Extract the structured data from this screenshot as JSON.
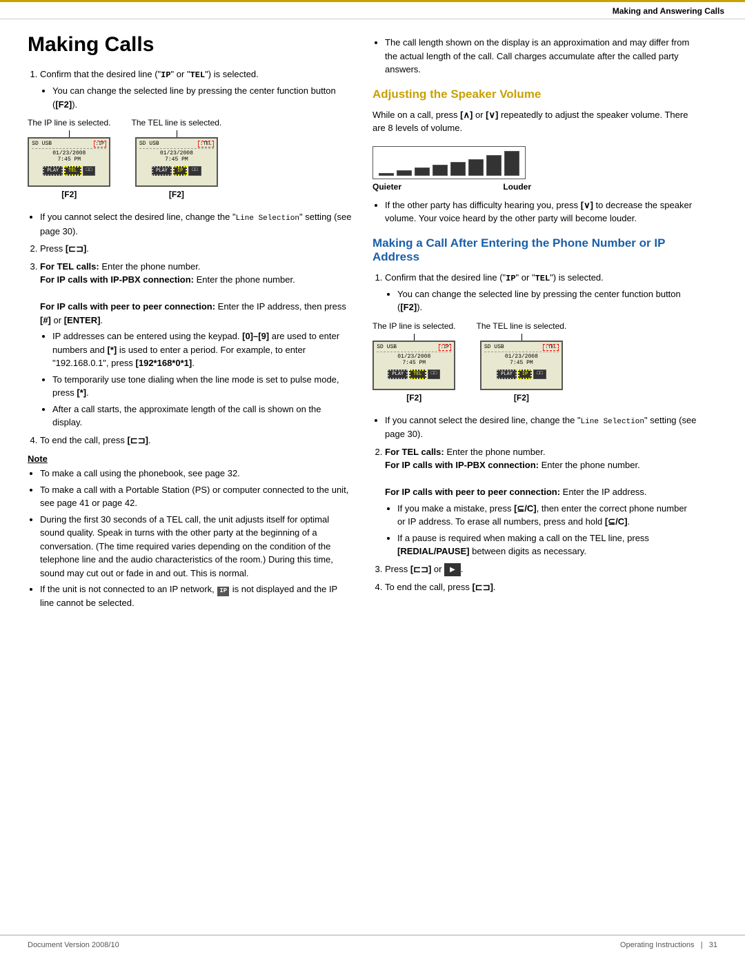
{
  "header": {
    "section_title": "Making and Answering Calls",
    "top_bar_color": "#c8a000"
  },
  "left_column": {
    "main_title": "Making Calls",
    "steps": [
      {
        "num": "1.",
        "text": "Confirm that the desired line (\"IP\" or \"TEL\") is selected.",
        "sub_bullets": [
          "You can change the selected line by pressing the center function button ([F2])."
        ]
      }
    ],
    "display_section": {
      "ip_label": "The IP line is selected.",
      "tel_label": "The TEL line is selected.",
      "f2_label": "[F2]",
      "f2_label2": "[F2]"
    },
    "after_display_bullets": [
      "If you cannot select the desired line, change the \"Line Selection\" setting (see page 30)."
    ],
    "step2": {
      "num": "2.",
      "text": "Press [⊏⊐]."
    },
    "step3": {
      "num": "3.",
      "text_parts": [
        {
          "bold": true,
          "text": "For TEL calls:"
        },
        {
          "bold": false,
          "text": " Enter the phone number."
        },
        {
          "bold": true,
          "text": "\nFor IP calls with IP-PBX connection:"
        },
        {
          "bold": false,
          "text": " Enter the phone number."
        },
        {
          "bold": true,
          "text": "\nFor IP calls with peer to peer connection:"
        },
        {
          "bold": false,
          "text": " Enter the IP address, then press [#] or [ENTER]."
        }
      ],
      "sub_bullets": [
        "IP addresses can be entered using the keypad. [0]–[9] are used to enter numbers and [*] is used to enter a period. For example, to enter \"192.168.0.1\", press [192*168*0*1].",
        "To temporarily use tone dialing when the line mode is set to pulse mode, press [*].",
        "After a call starts, the approximate length of the call is shown on the display."
      ]
    },
    "step4": {
      "num": "4.",
      "text": "To end the call, press [⊏⊐]."
    },
    "note_section": {
      "title": "Note",
      "bullets": [
        "To make a call using the phonebook, see page 32.",
        "To make a call with a Portable Station (PS) or computer connected to the unit, see page 41 or page 42.",
        "During the first 30 seconds of a TEL call, the unit adjusts itself for optimal sound quality. Speak in turns with the other party at the beginning of a conversation. (The time required varies depending on the condition of the telephone line and the audio characteristics of the room.) During this time, sound may cut out or fade in and out. This is normal.",
        "If the unit is not connected to an IP network, IP is not displayed and the IP line cannot be selected."
      ]
    }
  },
  "right_column": {
    "top_bullet": "The call length shown on the display is an approximation and may differ from the actual length of the call. Call charges accumulate after the called party answers.",
    "adjusting_section": {
      "title": "Adjusting the Speaker Volume",
      "intro": "While on a call, press [∧] or [∨] repeatedly to adjust the speaker volume. There are 8 levels of volume.",
      "volume_bars": [
        4,
        8,
        12,
        16,
        20,
        24,
        30,
        38
      ],
      "quieter_label": "Quieter",
      "louder_label": "Louder",
      "sub_bullet": "If the other party has difficulty hearing you, press [∨] to decrease the speaker volume. Your voice heard by the other party will become louder."
    },
    "making_call_section": {
      "title": "Making a Call After Entering the Phone Number or IP Address",
      "step1": {
        "num": "1.",
        "text": "Confirm that the desired line (\"IP\" or \"TEL\") is selected.",
        "sub_bullets": [
          "You can change the selected line by pressing the center function button ([F2])."
        ]
      },
      "display_section": {
        "ip_label": "The IP line is selected.",
        "tel_label": "The TEL line is selected.",
        "f2_label": "[F2]",
        "f2_label2": "[F2]"
      },
      "after_display_bullets": [
        "If you cannot select the desired line, change the \"Line Selection\" setting (see page 30)."
      ],
      "step2": {
        "num": "2.",
        "text_parts": [
          {
            "bold": true,
            "text": "For TEL calls:"
          },
          {
            "bold": false,
            "text": " Enter the phone number."
          },
          {
            "bold": true,
            "text": "\nFor IP calls with IP-PBX connection:"
          },
          {
            "bold": false,
            "text": " Enter the phone number."
          },
          {
            "bold": true,
            "text": "\nFor IP calls with peer to peer connection:"
          },
          {
            "bold": false,
            "text": " Enter the IP address."
          }
        ],
        "sub_bullets": [
          "If you make a mistake, press [⊆/C], then enter the correct phone number or IP address. To erase all numbers, press and hold [⊆/C].",
          "If a pause is required when making a call on the TEL line, press [REDIAL/PAUSE] between digits as necessary."
        ]
      },
      "step3": {
        "num": "3.",
        "text": "Press [⊏⊐] or"
      },
      "step4": {
        "num": "4.",
        "text": "To end the call, press [⊏⊐]."
      }
    }
  },
  "footer": {
    "left": "Document Version   2008/10",
    "right": "Operating Instructions",
    "page_num": "31"
  }
}
